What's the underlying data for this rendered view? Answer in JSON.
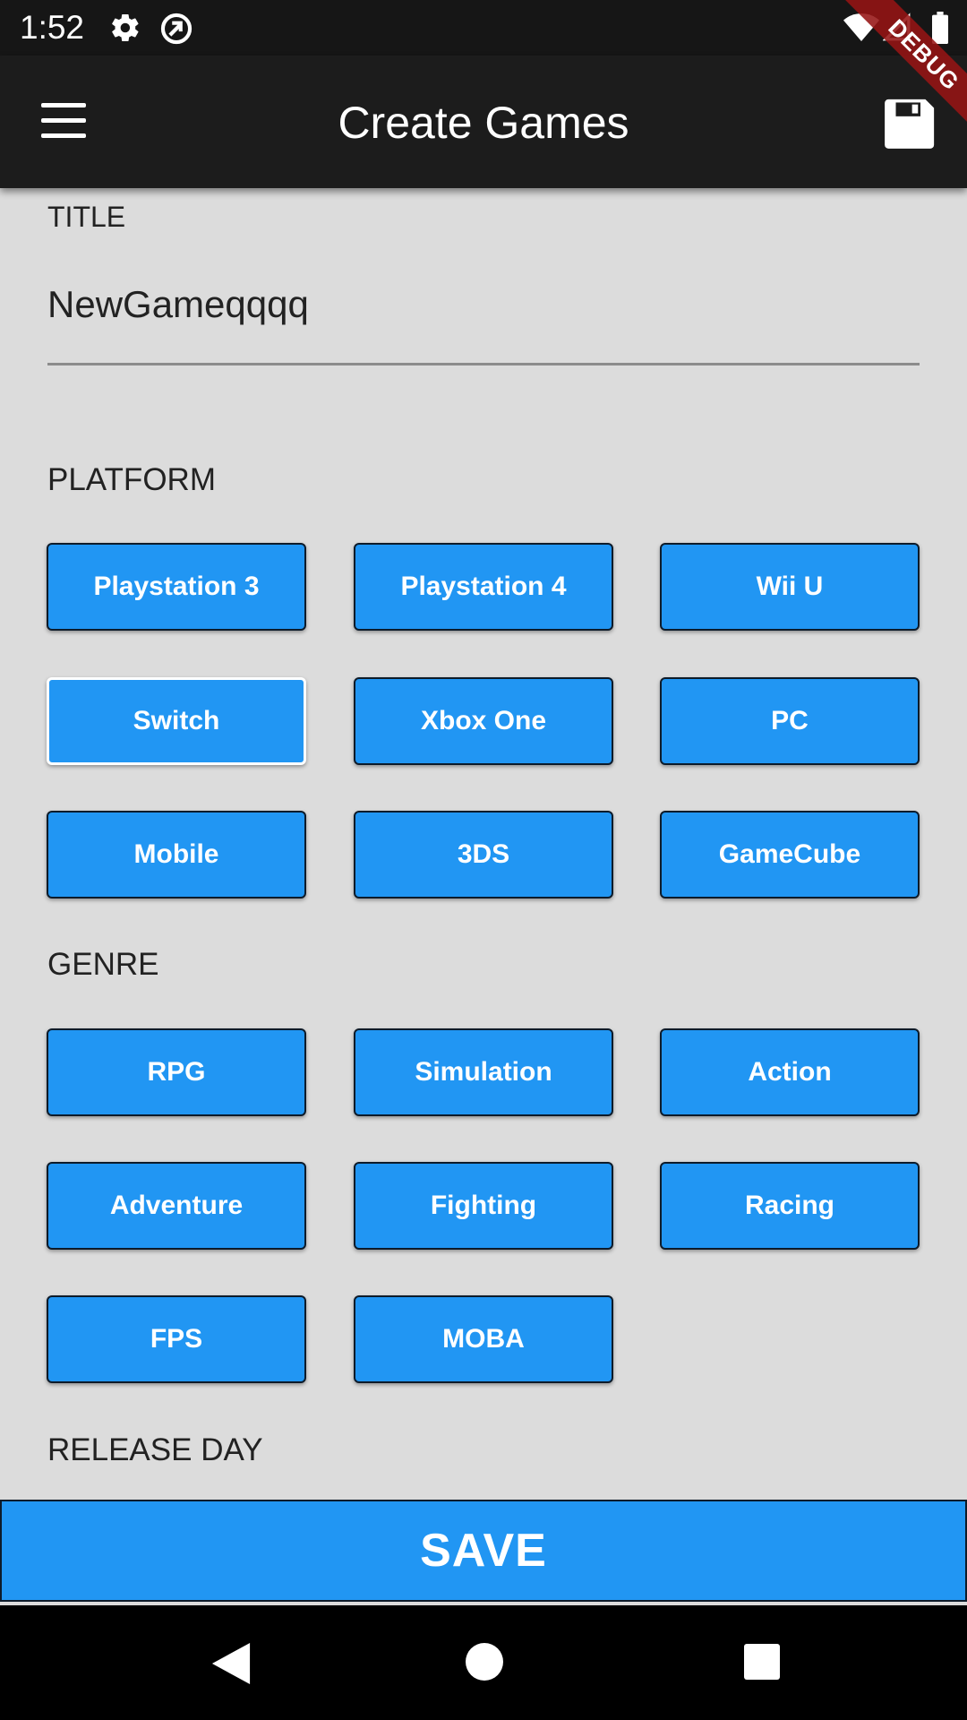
{
  "status_bar": {
    "time": "1:52"
  },
  "app_bar": {
    "title": "Create Games",
    "debug_label": "DEBUG"
  },
  "form": {
    "title_label": "TITLE",
    "title_value": "NewGameqqqq",
    "platform_label": "PLATFORM",
    "platforms": [
      {
        "label": "Playstation 3",
        "selected": false
      },
      {
        "label": "Playstation 4",
        "selected": false
      },
      {
        "label": "Wii U",
        "selected": false
      },
      {
        "label": "Switch",
        "selected": true
      },
      {
        "label": "Xbox One",
        "selected": false
      },
      {
        "label": "PC",
        "selected": false
      },
      {
        "label": "Mobile",
        "selected": false
      },
      {
        "label": "3DS",
        "selected": false
      },
      {
        "label": "GameCube",
        "selected": false
      }
    ],
    "genre_label": "GENRE",
    "genres": [
      {
        "label": "RPG",
        "selected": false
      },
      {
        "label": "Simulation",
        "selected": false
      },
      {
        "label": "Action",
        "selected": false
      },
      {
        "label": "Adventure",
        "selected": false
      },
      {
        "label": "Fighting",
        "selected": false
      },
      {
        "label": "Racing",
        "selected": false
      },
      {
        "label": "FPS",
        "selected": false
      },
      {
        "label": "MOBA",
        "selected": false
      }
    ],
    "release_label": "RELEASE DAY"
  },
  "save_button": {
    "label": "SAVE"
  },
  "colors": {
    "accent": "#2196f3",
    "app_bar": "#1c1c1c",
    "background": "#dcdcdc",
    "status_bar": "#161616"
  }
}
